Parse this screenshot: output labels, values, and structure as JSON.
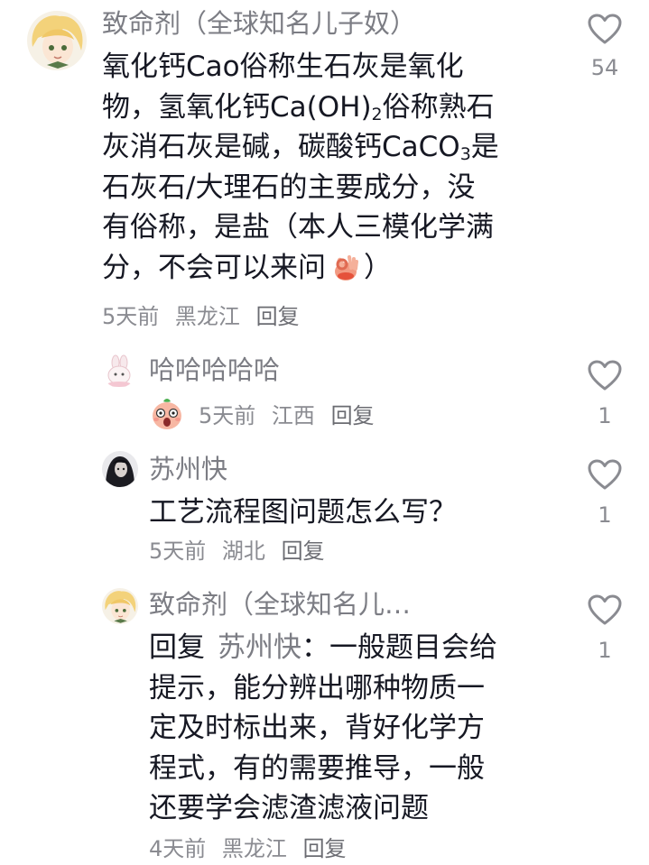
{
  "comment": {
    "author": "致命剂（全球知名儿子奴）",
    "text_line1": "氧化钙Cao俗称生石灰是氧化",
    "text_line2_a": "物，氢氧化钙Ca(OH)",
    "text_line2_sub": "2",
    "text_line2_b": "俗称熟石",
    "text_line3_a": "灰消石灰是碱，碳酸钙CaCO",
    "text_line3_sub": "3",
    "text_line3_b": "是",
    "text_line4": "石灰石/大理石的主要成分，没",
    "text_line5": "有俗称，是盐（本人三模化学满",
    "text_line6": "分，不会可以来问",
    "text_line6_end": "）",
    "emoji_icon": "ok-hand-icon",
    "time": "5天前",
    "location": "黑龙江",
    "reply_label": "回复",
    "likes": "54"
  },
  "replies": [
    {
      "author": "哈哈哈哈哈",
      "sticker_icon": "scared-face-sticker",
      "time": "5天前",
      "location": "江西",
      "reply_label": "回复",
      "likes": "1"
    },
    {
      "author": "苏州快",
      "text": "工艺流程图问题怎么写？",
      "time": "5天前",
      "location": "湖北",
      "reply_label": "回复",
      "likes": "1"
    },
    {
      "author": "致命剂（全球知名儿…",
      "reply_prefix": "回复",
      "mention": "苏州快",
      "text_line1": "：一般题目会给",
      "text_line2": "提示，能分辨出哪种物质一",
      "text_line3": "定及时标出来，背好化学方",
      "text_line4": "程式，有的需要推导，一般",
      "text_line5": "还要学会滤渣滤液问题",
      "time": "4天前",
      "location": "黑龙江",
      "reply_label": "回复",
      "likes": "1"
    }
  ],
  "colors": {
    "primary_text": "#161823",
    "secondary_text": "#7c7d84",
    "heart_outline": "#8a8b91"
  }
}
